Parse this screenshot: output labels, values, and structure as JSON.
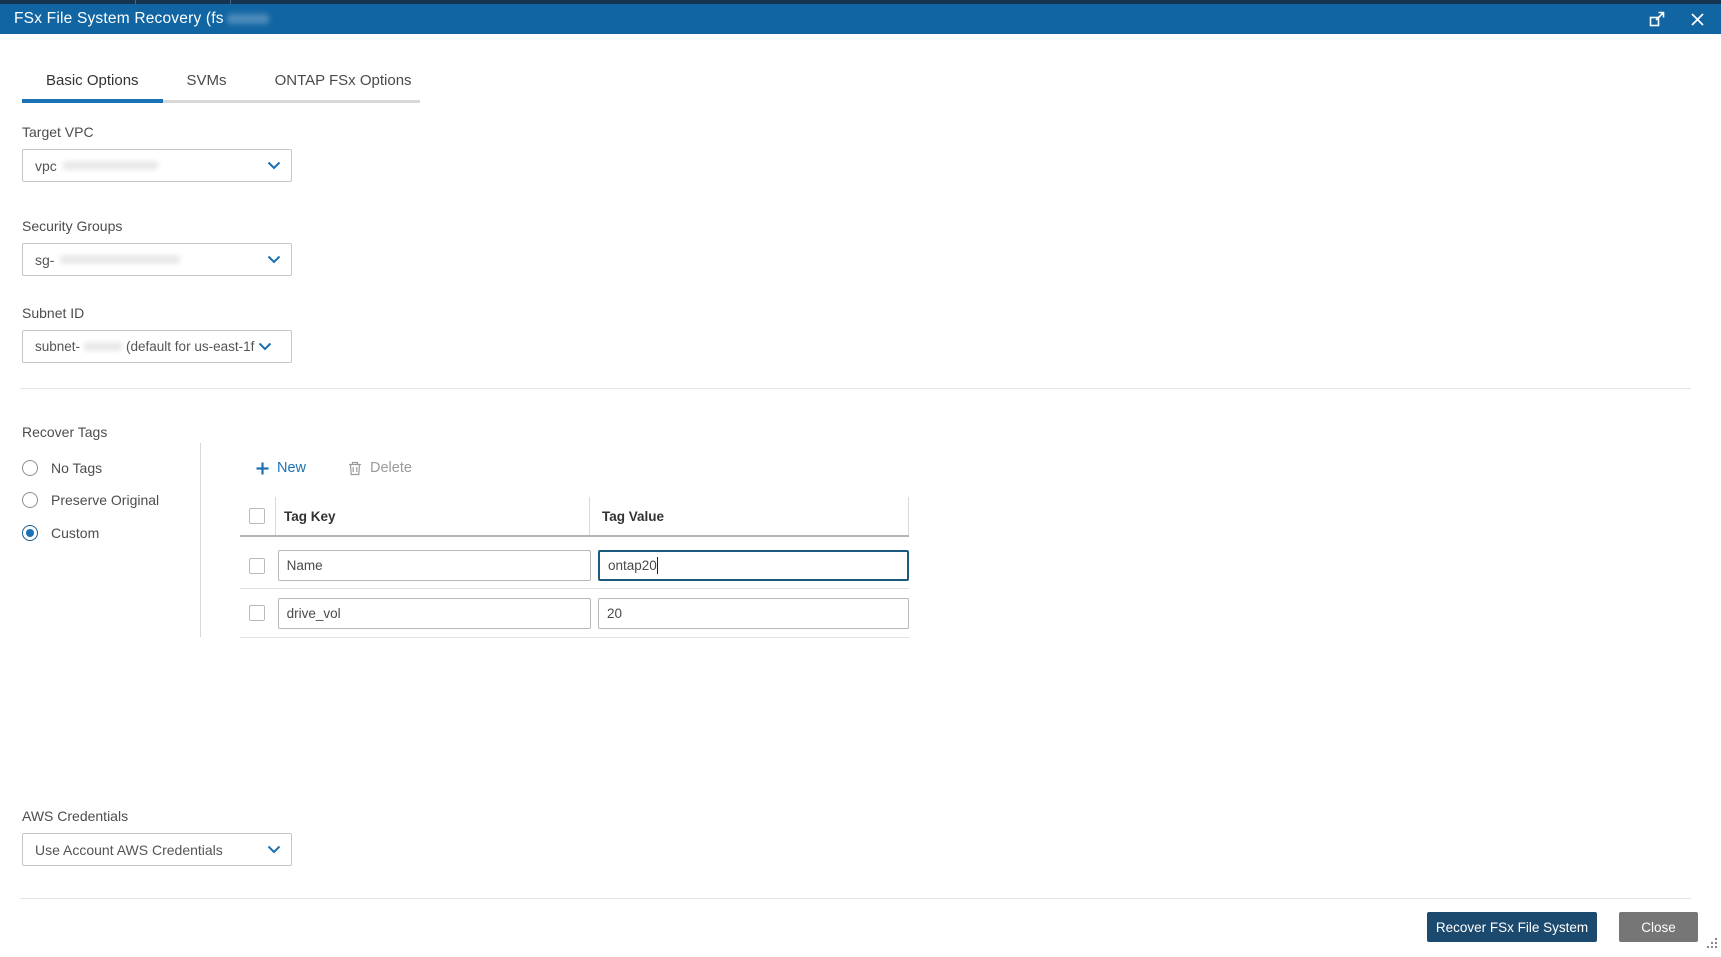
{
  "titlebar": {
    "title": "FSx File System Recovery (fs"
  },
  "tabs": [
    {
      "label": "Basic Options",
      "active": true
    },
    {
      "label": "SVMs",
      "active": false
    },
    {
      "label": "ONTAP FSx Options",
      "active": false
    }
  ],
  "fields": {
    "target_vpc": {
      "label": "Target VPC",
      "value": "vpc"
    },
    "security_groups": {
      "label": "Security Groups",
      "value": "sg-"
    },
    "subnet_id": {
      "label": "Subnet ID",
      "value": "subnet-",
      "value_suffix": "(default for us-east-1f"
    },
    "aws_credentials": {
      "label": "AWS Credentials",
      "value": "Use Account AWS Credentials"
    }
  },
  "recover_tags": {
    "label": "Recover Tags",
    "options": [
      {
        "label": "No Tags",
        "selected": false
      },
      {
        "label": "Preserve Original",
        "selected": false
      },
      {
        "label": "Custom",
        "selected": true
      }
    ],
    "toolbar": {
      "new_label": "New",
      "delete_label": "Delete"
    },
    "table": {
      "columns": [
        "Tag Key",
        "Tag Value"
      ],
      "rows": [
        {
          "key": "Name",
          "value": "ontap20",
          "focused": "value"
        },
        {
          "key": "drive_vol",
          "value": "20"
        }
      ]
    }
  },
  "footer": {
    "recover_label": "Recover FSx File System",
    "close_label": "Close"
  },
  "icons": [
    "expand-icon",
    "close-icon",
    "chevron-down-icon",
    "plus-icon",
    "trash-icon",
    "resize-grip"
  ],
  "colors": {
    "titlebar_bg": "#1165a3",
    "accent_blue": "#1a72b5",
    "recover_button_bg": "#1c4a6e",
    "close_button_bg": "#767676",
    "focused_input_border": "#1b5a7e"
  }
}
